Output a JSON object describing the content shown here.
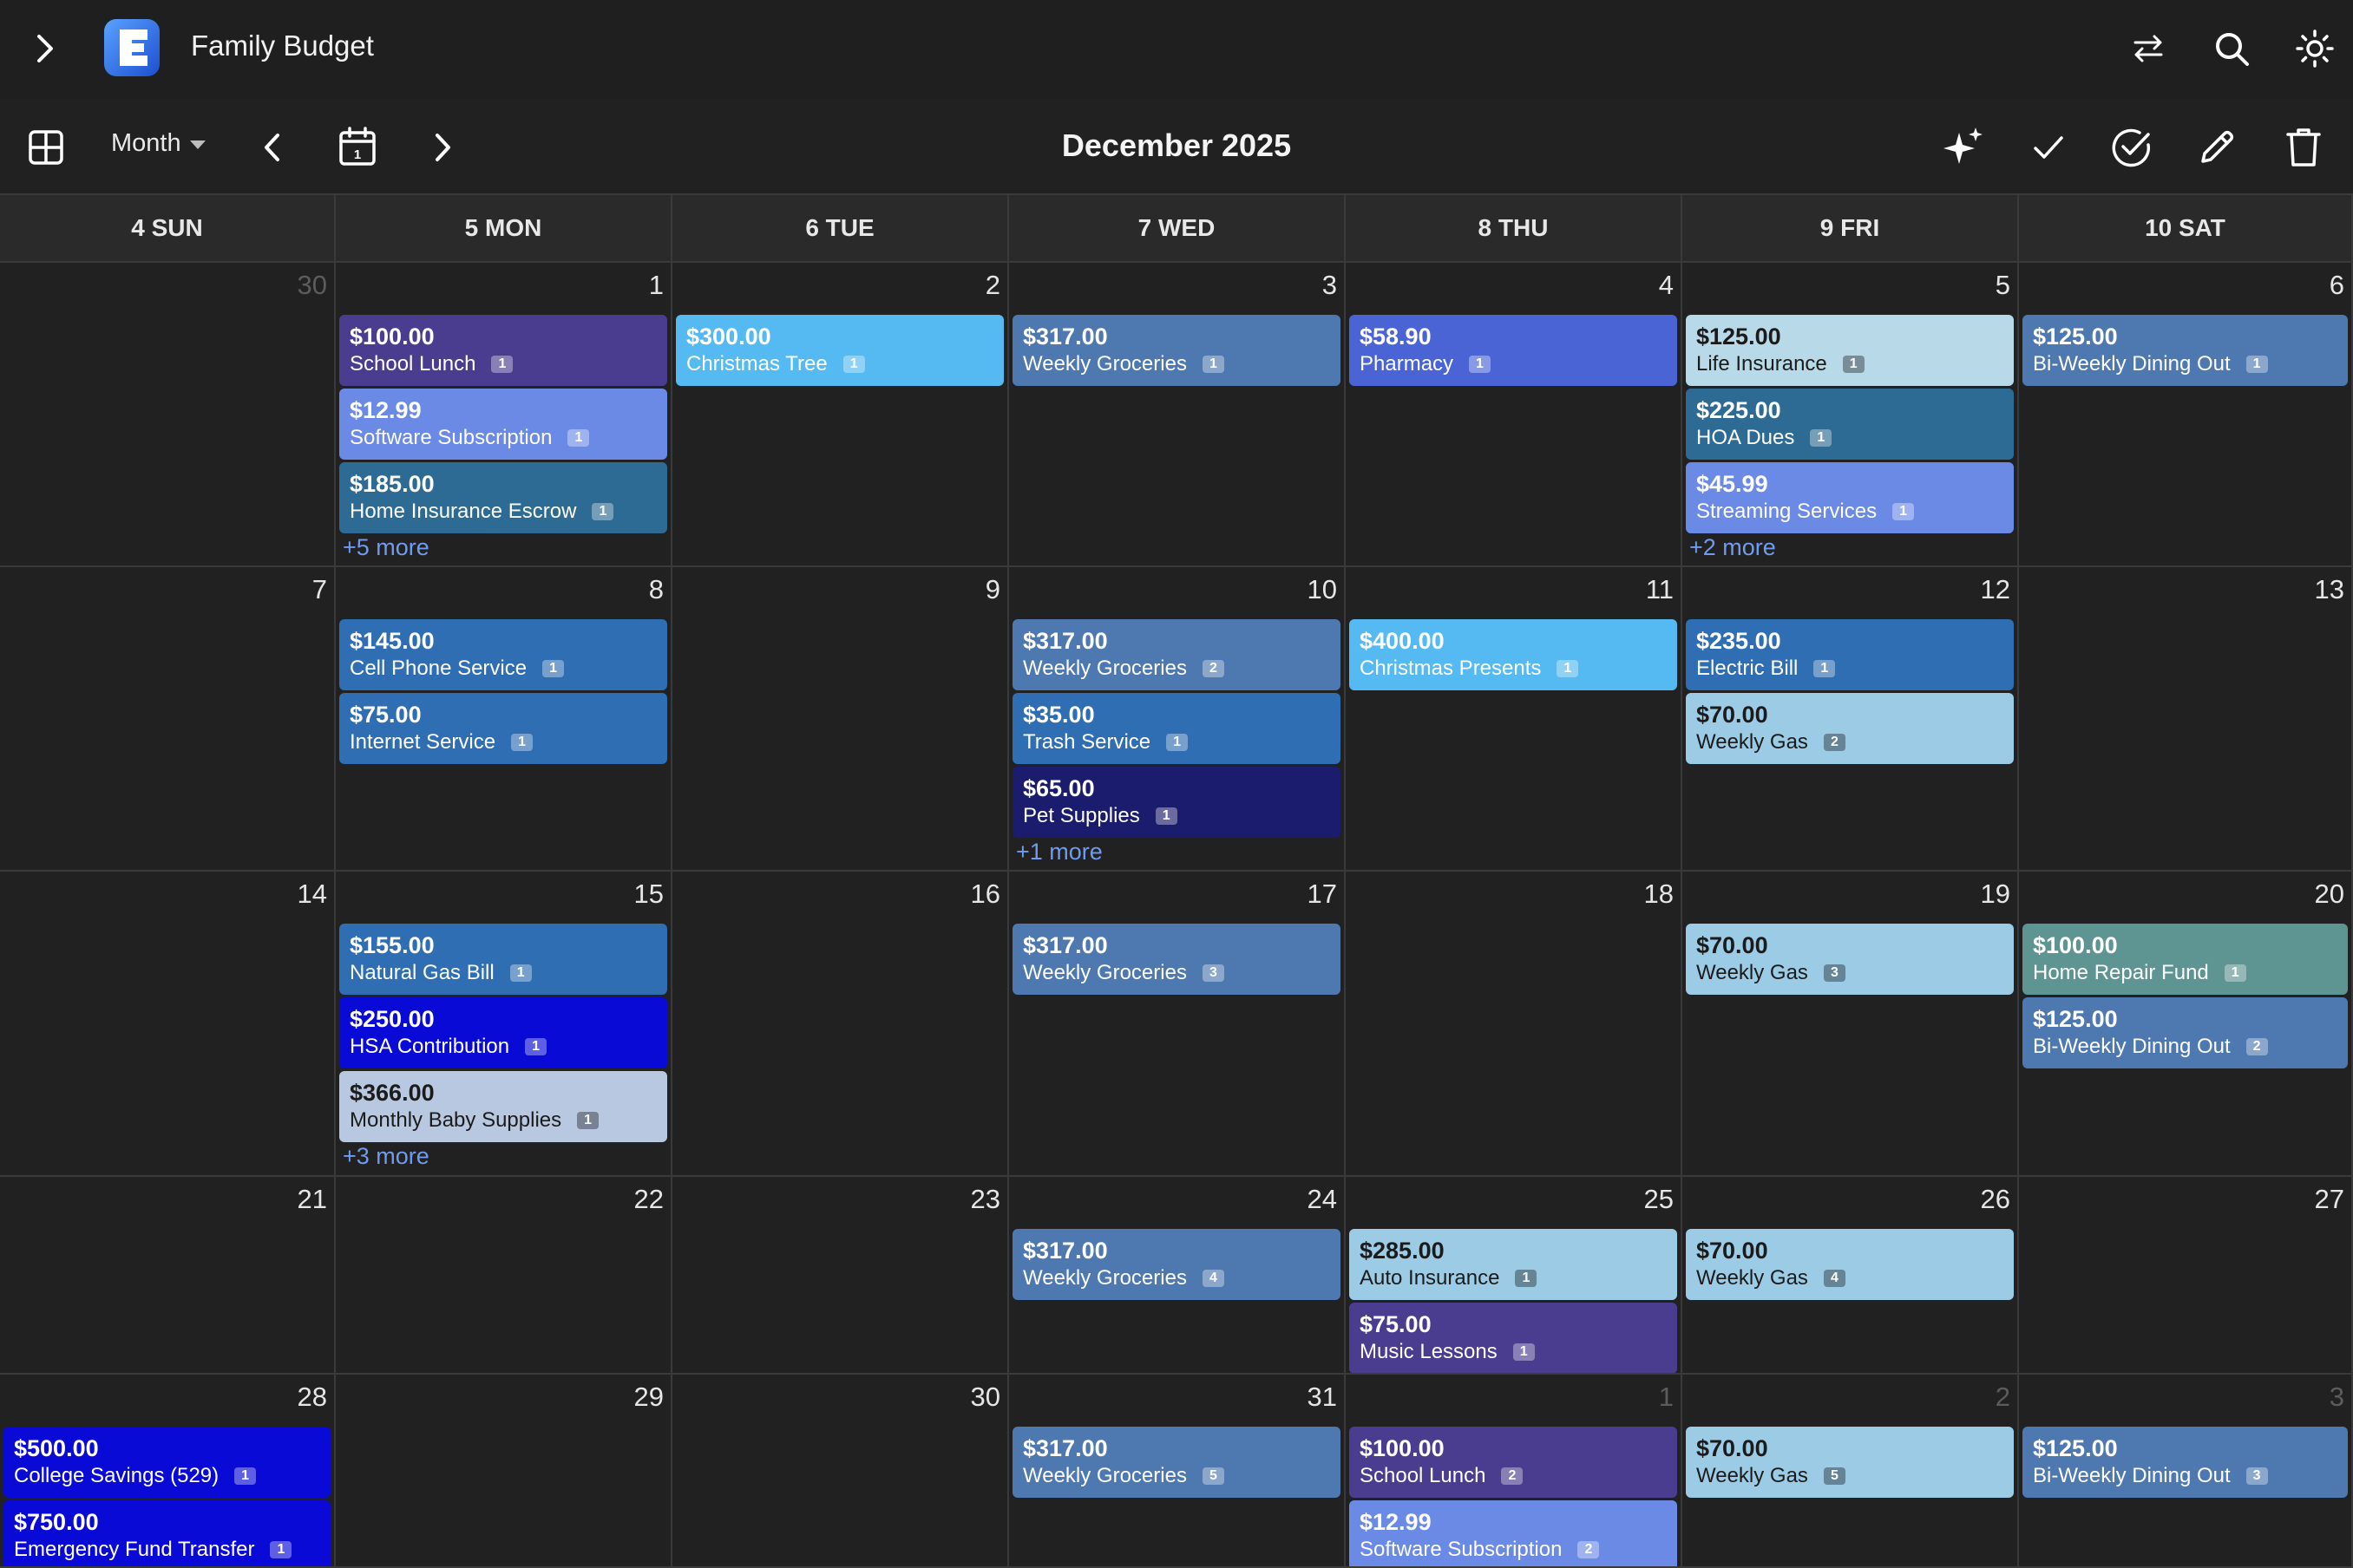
{
  "app": {
    "title": "Family Budget",
    "logo_letter": "E"
  },
  "toolbar": {
    "view_label": "Month",
    "month_title": "December 2025"
  },
  "weekdays": [
    "4 SUN",
    "5 MON",
    "6 TUE",
    "7 WED",
    "8 THU",
    "9 FRI",
    "10 SAT"
  ],
  "colors": {
    "purple": "#4a3d8f",
    "periwinkle": "#6a8ae6",
    "steel": "#2e6b94",
    "sky": "#55b9f2",
    "slate_blue": "#4e78b0",
    "royal": "#4a64d6",
    "pale_blue": "#b8d9e8",
    "mid_blue": "#2f6eb3",
    "light_blue": "#9ccbe6",
    "navy": "#1c1c6e",
    "pure_blue": "#0a0ad6",
    "lavender": "#b8c8e0",
    "teal": "#5e9492",
    "link": "#6f9bf0"
  },
  "weeks": [
    [
      {
        "day": "30",
        "dim": true,
        "events": []
      },
      {
        "day": "1",
        "events": [
          {
            "amount": "$100.00",
            "name": "School Lunch",
            "count": "1",
            "color": "#4a3d8f"
          },
          {
            "amount": "$12.99",
            "name": "Software Subscription",
            "count": "1",
            "color": "#6a8ae6"
          },
          {
            "amount": "$185.00",
            "name": "Home Insurance Escrow",
            "count": "1",
            "color": "#2e6b94"
          }
        ],
        "more": "+5 more"
      },
      {
        "day": "2",
        "events": [
          {
            "amount": "$300.00",
            "name": "Christmas Tree",
            "count": "1",
            "color": "#55b9f2"
          }
        ]
      },
      {
        "day": "3",
        "events": [
          {
            "amount": "$317.00",
            "name": "Weekly Groceries",
            "count": "1",
            "color": "#4e78b0"
          }
        ]
      },
      {
        "day": "4",
        "events": [
          {
            "amount": "$58.90",
            "name": "Pharmacy",
            "count": "1",
            "color": "#4a64d6"
          }
        ]
      },
      {
        "day": "5",
        "events": [
          {
            "amount": "$125.00",
            "name": "Life Insurance",
            "count": "1",
            "color": "#b8d9e8",
            "dark": true
          },
          {
            "amount": "$225.00",
            "name": "HOA Dues",
            "count": "1",
            "color": "#2e6b94"
          },
          {
            "amount": "$45.99",
            "name": "Streaming Services",
            "count": "1",
            "color": "#6a8ae6"
          }
        ],
        "more": "+2 more"
      },
      {
        "day": "6",
        "events": [
          {
            "amount": "$125.00",
            "name": "Bi-Weekly Dining Out",
            "count": "1",
            "color": "#4e78b0"
          }
        ]
      }
    ],
    [
      {
        "day": "7",
        "events": []
      },
      {
        "day": "8",
        "events": [
          {
            "amount": "$145.00",
            "name": "Cell Phone Service",
            "count": "1",
            "color": "#2f6eb3"
          },
          {
            "amount": "$75.00",
            "name": "Internet Service",
            "count": "1",
            "color": "#2f6eb3"
          }
        ]
      },
      {
        "day": "9",
        "events": []
      },
      {
        "day": "10",
        "events": [
          {
            "amount": "$317.00",
            "name": "Weekly Groceries",
            "count": "2",
            "color": "#4e78b0"
          },
          {
            "amount": "$35.00",
            "name": "Trash Service",
            "count": "1",
            "color": "#2f6eb3"
          },
          {
            "amount": "$65.00",
            "name": "Pet Supplies",
            "count": "1",
            "color": "#1c1c6e"
          }
        ],
        "more": "+1 more"
      },
      {
        "day": "11",
        "events": [
          {
            "amount": "$400.00",
            "name": "Christmas Presents",
            "count": "1",
            "color": "#55b9f2"
          }
        ]
      },
      {
        "day": "12",
        "events": [
          {
            "amount": "$235.00",
            "name": "Electric Bill",
            "count": "1",
            "color": "#2f6eb3"
          },
          {
            "amount": "$70.00",
            "name": "Weekly Gas",
            "count": "2",
            "color": "#9ccbe6",
            "dark": true
          }
        ]
      },
      {
        "day": "13",
        "events": []
      }
    ],
    [
      {
        "day": "14",
        "events": []
      },
      {
        "day": "15",
        "events": [
          {
            "amount": "$155.00",
            "name": "Natural Gas Bill",
            "count": "1",
            "color": "#2f6eb3"
          },
          {
            "amount": "$250.00",
            "name": "HSA Contribution",
            "count": "1",
            "color": "#0a0ad6"
          },
          {
            "amount": "$366.00",
            "name": "Monthly Baby Supplies",
            "count": "1",
            "color": "#b8c8e0",
            "dark": true
          }
        ],
        "more": "+3 more"
      },
      {
        "day": "16",
        "events": []
      },
      {
        "day": "17",
        "events": [
          {
            "amount": "$317.00",
            "name": "Weekly Groceries",
            "count": "3",
            "color": "#4e78b0"
          }
        ]
      },
      {
        "day": "18",
        "events": []
      },
      {
        "day": "19",
        "events": [
          {
            "amount": "$70.00",
            "name": "Weekly Gas",
            "count": "3",
            "color": "#9ccbe6",
            "dark": true
          }
        ]
      },
      {
        "day": "20",
        "events": [
          {
            "amount": "$100.00",
            "name": "Home Repair Fund",
            "count": "1",
            "color": "#5e9492"
          },
          {
            "amount": "$125.00",
            "name": "Bi-Weekly Dining Out",
            "count": "2",
            "color": "#4e78b0"
          }
        ]
      }
    ],
    [
      {
        "day": "21",
        "events": []
      },
      {
        "day": "22",
        "events": []
      },
      {
        "day": "23",
        "events": []
      },
      {
        "day": "24",
        "events": [
          {
            "amount": "$317.00",
            "name": "Weekly Groceries",
            "count": "4",
            "color": "#4e78b0"
          }
        ]
      },
      {
        "day": "25",
        "events": [
          {
            "amount": "$285.00",
            "name": "Auto Insurance",
            "count": "1",
            "color": "#9ccbe6",
            "dark": true
          },
          {
            "amount": "$75.00",
            "name": "Music Lessons",
            "count": "1",
            "color": "#4a3d8f"
          }
        ]
      },
      {
        "day": "26",
        "events": [
          {
            "amount": "$70.00",
            "name": "Weekly Gas",
            "count": "4",
            "color": "#9ccbe6",
            "dark": true
          }
        ]
      },
      {
        "day": "27",
        "events": []
      }
    ],
    [
      {
        "day": "28",
        "events": [
          {
            "amount": "$500.00",
            "name": "College Savings (529)",
            "count": "1",
            "color": "#0a0ad6"
          },
          {
            "amount": "$750.00",
            "name": "Emergency Fund Transfer",
            "count": "1",
            "color": "#0a0ad6"
          }
        ]
      },
      {
        "day": "29",
        "events": []
      },
      {
        "day": "30",
        "events": []
      },
      {
        "day": "31",
        "events": [
          {
            "amount": "$317.00",
            "name": "Weekly Groceries",
            "count": "5",
            "color": "#4e78b0"
          }
        ]
      },
      {
        "day": "1",
        "dim": true,
        "events": [
          {
            "amount": "$100.00",
            "name": "School Lunch",
            "count": "2",
            "color": "#4a3d8f"
          },
          {
            "amount": "$12.99",
            "name": "Software Subscription",
            "count": "2",
            "color": "#6a8ae6"
          }
        ]
      },
      {
        "day": "2",
        "dim": true,
        "events": [
          {
            "amount": "$70.00",
            "name": "Weekly Gas",
            "count": "5",
            "color": "#9ccbe6",
            "dark": true
          }
        ]
      },
      {
        "day": "3",
        "dim": true,
        "events": [
          {
            "amount": "$125.00",
            "name": "Bi-Weekly Dining Out",
            "count": "3",
            "color": "#4e78b0"
          }
        ]
      }
    ]
  ]
}
